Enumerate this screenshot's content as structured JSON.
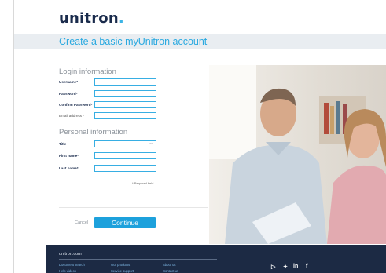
{
  "brand": {
    "logo_text": "unitron",
    "logo_dot": "."
  },
  "page": {
    "title": "Create a basic myUnitron account"
  },
  "login": {
    "heading": "Login information",
    "username_label": "Username*",
    "password_label": "Password*",
    "confirm_label": "Confirm Password*",
    "email_label": "Email address *"
  },
  "personal": {
    "heading": "Personal information",
    "title_label": "Title",
    "first_label": "First name*",
    "last_label": "Last name*"
  },
  "required_note": "* Required field",
  "actions": {
    "cancel": "Cancel",
    "continue": "Continue"
  },
  "footer": {
    "brand": "unitron.com",
    "links_row1": [
      "Document search",
      "Our products",
      "About us"
    ],
    "links_row2": [
      "Help videos",
      "Service support",
      "Contact us"
    ],
    "social": [
      "youtube-icon",
      "twitter-icon",
      "linkedin-icon",
      "facebook-icon"
    ]
  },
  "colors": {
    "accent": "#2aa9e0",
    "button": "#1da1dc",
    "navy": "#1c2a44",
    "band": "#e9edf1"
  }
}
